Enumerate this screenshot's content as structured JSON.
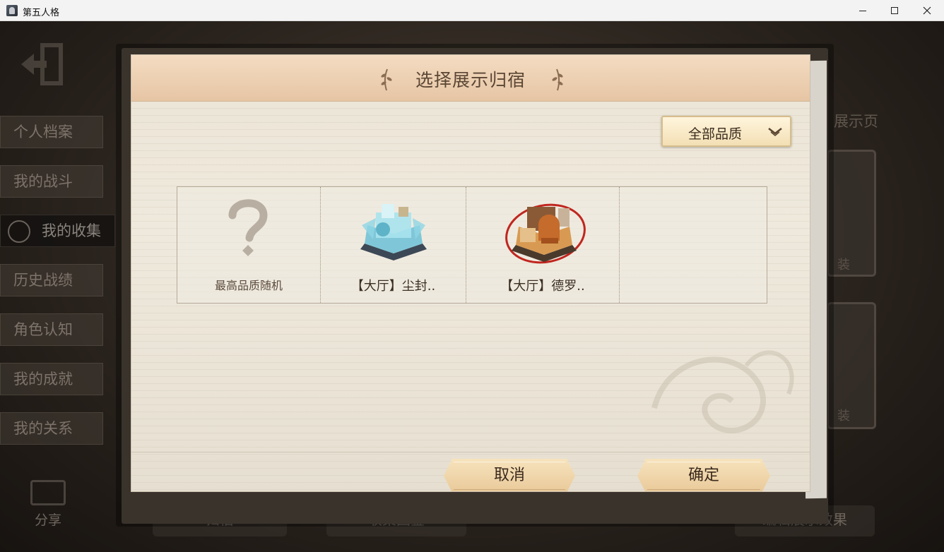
{
  "window": {
    "title": "第五人格",
    "minimize_icon": "minimize-icon",
    "maximize_icon": "maximize-icon",
    "close_icon": "close-icon"
  },
  "sidebar": {
    "items": [
      {
        "label": "个人档案"
      },
      {
        "label": "我的战斗"
      },
      {
        "label": "我的收集",
        "active": true
      },
      {
        "label": "历史战绩"
      },
      {
        "label": "角色认知"
      },
      {
        "label": "我的成就"
      },
      {
        "label": "我的关系"
      }
    ],
    "share_label": "分享"
  },
  "background": {
    "right_title": "展示页",
    "card_label_1": "装",
    "card_label_2": "装",
    "bottom_tabs": [
      "归宿",
      "收集图鉴",
      "编辑展示效果"
    ]
  },
  "modal": {
    "title": "选择展示归宿",
    "quality_filter": "全部品质",
    "items": [
      {
        "label": "最高品质随机",
        "icon": "question-mark-icon"
      },
      {
        "label": "【大厅】尘封..",
        "icon": "hall-dusty-icon"
      },
      {
        "label": "【大厅】德罗..",
        "icon": "hall-dero-icon"
      }
    ],
    "cancel_label": "取消",
    "confirm_label": "确定"
  },
  "colors": {
    "modal_paper": "#efe9dd",
    "header_tint": "#e6c5a4",
    "button_gold": "#e9c999",
    "text_dark": "#3a2c1e"
  }
}
